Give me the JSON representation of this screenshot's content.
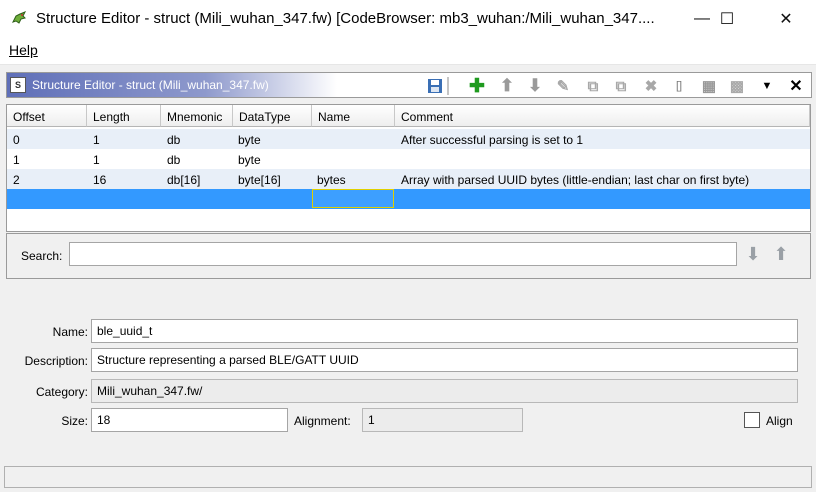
{
  "window": {
    "title": "Structure Editor - struct (Mili_wuhan_347.fw) [CodeBrowser: mb3_wuhan:/Mili_wuhan_347....",
    "controls": {
      "minimize": "—",
      "maximize": "☐",
      "close": "✕"
    }
  },
  "menu": {
    "help": "Help"
  },
  "panel": {
    "title": "Structure Editor - struct (Mili_wuhan_347.fw)",
    "icon_letter": "S",
    "toolbar": [
      {
        "name": "save-icon",
        "glyph": "💾",
        "color": "#3a6fb5"
      },
      {
        "name": "add-icon",
        "glyph": "✚",
        "color": "#1e9a1e"
      },
      {
        "name": "move-up-icon",
        "glyph": "⬆",
        "color": "#9a9a9a"
      },
      {
        "name": "move-down-icon",
        "glyph": "⬇",
        "color": "#9a9a9a"
      },
      {
        "name": "edit-icon",
        "glyph": "✎",
        "color": "#a8a8a8"
      },
      {
        "name": "duplicate-icon",
        "glyph": "⧉",
        "color": "#a8a8a8"
      },
      {
        "name": "duplicate-multiple-icon",
        "glyph": "⧉",
        "color": "#a8a8a8"
      },
      {
        "name": "delete-icon",
        "glyph": "✖",
        "color": "#a8a8a8"
      },
      {
        "name": "array-icon",
        "glyph": "[]",
        "color": "#777777"
      },
      {
        "name": "unpackage-icon",
        "glyph": "▦",
        "color": "#999999"
      },
      {
        "name": "create-structure-icon",
        "glyph": "▩",
        "color": "#aaaaaa"
      }
    ],
    "menu_arrow": "▼",
    "close": "✕"
  },
  "table": {
    "columns": [
      "Offset",
      "Length",
      "Mnemonic",
      "DataType",
      "Name",
      "Comment"
    ],
    "rows": [
      {
        "offset": "0",
        "length": "1",
        "mnemonic": "db",
        "datatype": "byte",
        "name": "",
        "comment": "After successful parsing is set to 1"
      },
      {
        "offset": "1",
        "length": "1",
        "mnemonic": "db",
        "datatype": "byte",
        "name": "",
        "comment": ""
      },
      {
        "offset": "2",
        "length": "16",
        "mnemonic": "db[16]",
        "datatype": "byte[16]",
        "name": "bytes",
        "comment": "Array with parsed UUID bytes (little-endian; last char on first byte)"
      }
    ],
    "selection_color": "#3399ff"
  },
  "search": {
    "label": "Search:",
    "value": ""
  },
  "details": {
    "name_label": "Name:",
    "name_value": "ble_uuid_t",
    "description_label": "Description:",
    "description_value": "Structure representing a parsed BLE/GATT UUID",
    "category_label": "Category:",
    "category_value": "Mili_wuhan_347.fw/",
    "size_label": "Size:",
    "size_value": "18",
    "alignment_label": "Alignment:",
    "alignment_value": "1",
    "align_label": "Align"
  }
}
